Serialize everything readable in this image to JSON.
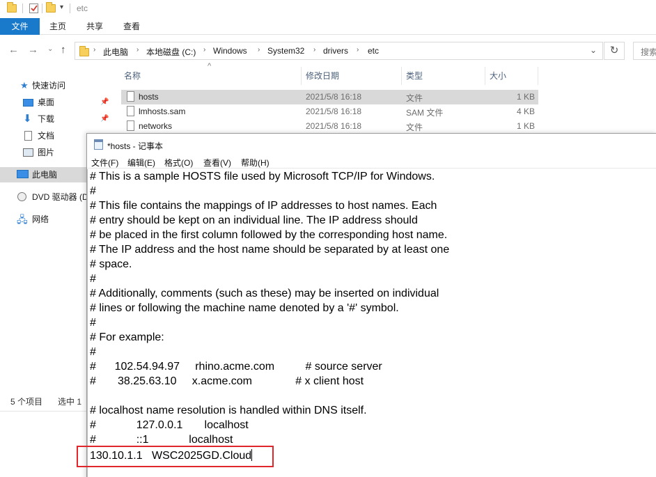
{
  "explorer": {
    "title": "etc",
    "quick_access_icons": [
      "folder-icon",
      "properties-icon",
      "new-folder-icon",
      "customize-dropdown-icon"
    ],
    "ribbon_tabs": [
      "文件",
      "主页",
      "共享",
      "查看"
    ],
    "nav_buttons": [
      "back-arrow-icon",
      "forward-arrow-icon",
      "recent-dropdown-icon",
      "up-arrow-icon"
    ],
    "breadcrumb": [
      "此电脑",
      "本地磁盘 (C:)",
      "Windows",
      "System32",
      "drivers",
      "etc"
    ],
    "search_placeholder": "搜索",
    "nav_pane": {
      "quick_access": "快速访问",
      "items": [
        "桌面",
        "下载",
        "文档",
        "图片"
      ],
      "this_pc": "此电脑",
      "dvd": "DVD 驱动器 (D",
      "network": "网络"
    },
    "columns": [
      "名称",
      "修改日期",
      "类型",
      "大小"
    ],
    "files": [
      {
        "name": "hosts",
        "date": "2021/5/8 16:18",
        "type": "文件",
        "size": "1 KB",
        "selected": true
      },
      {
        "name": "lmhosts.sam",
        "date": "2021/5/8 16:18",
        "type": "SAM 文件",
        "size": "4 KB",
        "selected": false
      },
      {
        "name": "networks",
        "date": "2021/5/8 16:18",
        "type": "文件",
        "size": "1 KB",
        "selected": false
      }
    ],
    "status": {
      "count": "5 个项目",
      "selected": "选中 1"
    }
  },
  "notepad": {
    "title": "*hosts - 记事本",
    "menu": [
      "文件(F)",
      "编辑(E)",
      "格式(O)",
      "查看(V)",
      "帮助(H)"
    ],
    "lines": [
      "# This is a sample HOSTS file used by Microsoft TCP/IP for Windows.",
      "#",
      "# This file contains the mappings of IP addresses to host names. Each",
      "# entry should be kept on an individual line. The IP address should",
      "# be placed in the first column followed by the corresponding host name.",
      "# The IP address and the host name should be separated by at least one",
      "# space.",
      "#",
      "# Additionally, comments (such as these) may be inserted on individual",
      "# lines or following the machine name denoted by a '#' symbol.",
      "#",
      "# For example:",
      "#",
      "#      102.54.94.97     rhino.acme.com          # source server",
      "#       38.25.63.10     x.acme.com              # x client host",
      "",
      "# localhost name resolution is handled within DNS itself.",
      "#             127.0.0.1       localhost",
      "#             ::1             localhost",
      "130.10.1.1   WSC2025GD.Cloud"
    ],
    "highlight_color": "#e0262a"
  }
}
